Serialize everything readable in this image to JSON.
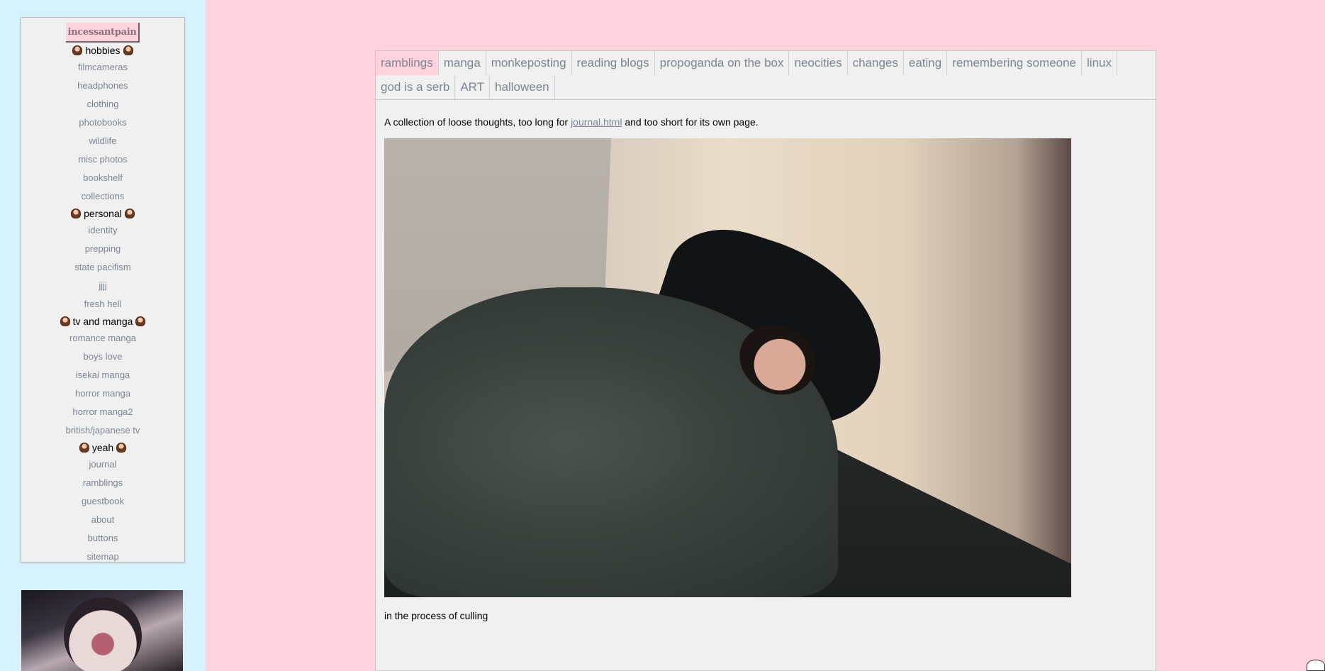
{
  "sidebar": {
    "site_name": "incessantpain",
    "sections": [
      {
        "title": "hobbies",
        "items": [
          "filmcameras",
          "headphones",
          "clothing",
          "photobooks",
          "wildlife",
          "misc photos",
          "bookshelf",
          "collections"
        ]
      },
      {
        "title": "personal",
        "items": [
          "identity",
          "prepping",
          "state pacifism",
          "jjjj",
          "fresh hell"
        ]
      },
      {
        "title": "tv and manga",
        "items": [
          "romance manga",
          "boys love",
          "isekai manga",
          "horror manga",
          "horror manga2",
          "british/japanese tv"
        ]
      },
      {
        "title": "yeah",
        "items": [
          "journal",
          "ramblings",
          "guestbook",
          "about",
          "buttons",
          "sitemap"
        ]
      }
    ]
  },
  "tabs": [
    {
      "label": "ramblings",
      "active": true
    },
    {
      "label": "manga"
    },
    {
      "label": "monkeposting"
    },
    {
      "label": "reading blogs"
    },
    {
      "label": "propoganda on the box"
    },
    {
      "label": "neocities"
    },
    {
      "label": "changes"
    },
    {
      "label": "eating"
    },
    {
      "label": "remembering someone"
    },
    {
      "label": "linux"
    },
    {
      "label": "god is a serb"
    },
    {
      "label": "ART"
    },
    {
      "label": "halloween"
    }
  ],
  "content": {
    "intro_before": "A collection of loose thoughts, too long for ",
    "intro_link": "journal.html",
    "intro_after": " and too short for its own page.",
    "caption": "in the process of culling"
  },
  "colors": {
    "page_bg": "#ffd3de",
    "left_bg": "#d4f1fc",
    "panel_bg": "#f0f0f0",
    "link": "#7d8592",
    "active_tab": "#ffd3de"
  }
}
